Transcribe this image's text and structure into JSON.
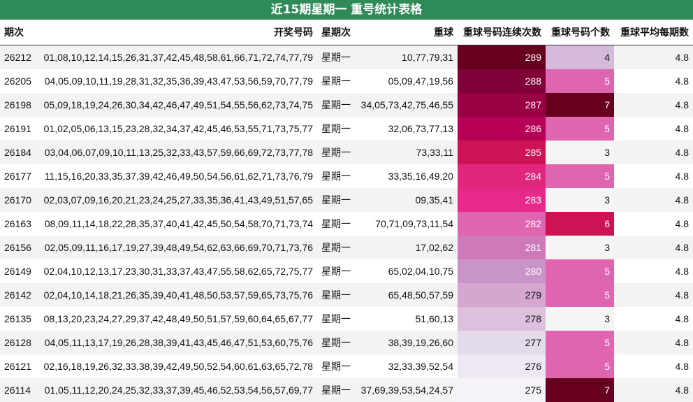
{
  "title": "近15期星期一 重号统计表格",
  "headers": {
    "period": "期次",
    "numbers": "开奖号码",
    "weekday": "星期次",
    "repeat": "重球",
    "consecutive": "重球号码连续次数",
    "count": "重球号码个数",
    "avg": "重球平均每期数"
  },
  "colors": {
    "title_bg": "#2e8b57",
    "consecutive_scale": [
      "#67001f",
      "#7f0036",
      "#980043",
      "#b70055",
      "#ce1256",
      "#e0267d",
      "#e7298a",
      "#df65b0",
      "#cf7ab8",
      "#c994c7",
      "#d4a6d0",
      "#dcc0dc",
      "#e4dbea",
      "#ede8f3",
      "#f5f2f8"
    ],
    "count_colors": {
      "3": "#f5f5f5",
      "4": "#d4b9da",
      "5": "#df65b0",
      "6": "#ce1256",
      "7": "#67001f"
    }
  },
  "rows": [
    {
      "period": "26212",
      "numbers": "01,08,10,12,14,15,26,31,37,42,45,48,58,61,66,71,72,74,77,79",
      "weekday": "星期一",
      "repeat": "10,77,79,31",
      "consecutive": 289,
      "count": 4,
      "avg": "4.8"
    },
    {
      "period": "26205",
      "numbers": "04,05,09,10,11,19,28,31,32,35,36,39,43,47,53,56,59,70,77,79",
      "weekday": "星期一",
      "repeat": "05,09,47,19,56",
      "consecutive": 288,
      "count": 5,
      "avg": "4.8"
    },
    {
      "period": "26198",
      "numbers": "05,09,18,19,24,26,30,34,42,46,47,49,51,54,55,56,62,73,74,75",
      "weekday": "星期一",
      "repeat": "34,05,73,42,75,46,55",
      "consecutive": 287,
      "count": 7,
      "avg": "4.8"
    },
    {
      "period": "26191",
      "numbers": "01,02,05,06,13,15,23,28,32,34,37,42,45,46,53,55,71,73,75,77",
      "weekday": "星期一",
      "repeat": "32,06,73,77,13",
      "consecutive": 286,
      "count": 5,
      "avg": "4.8"
    },
    {
      "period": "26184",
      "numbers": "03,04,06,07,09,10,11,13,25,32,33,43,57,59,66,69,72,73,77,78",
      "weekday": "星期一",
      "repeat": "73,33,11",
      "consecutive": 285,
      "count": 3,
      "avg": "4.8"
    },
    {
      "period": "26177",
      "numbers": "11,15,16,20,33,35,37,39,42,46,49,50,54,56,61,62,71,73,76,79",
      "weekday": "星期一",
      "repeat": "33,35,16,49,20",
      "consecutive": 284,
      "count": 5,
      "avg": "4.8"
    },
    {
      "period": "26170",
      "numbers": "02,03,07,09,16,20,21,23,24,25,27,33,35,36,41,43,49,51,57,65",
      "weekday": "星期一",
      "repeat": "09,35,41",
      "consecutive": 283,
      "count": 3,
      "avg": "4.8"
    },
    {
      "period": "26163",
      "numbers": "08,09,11,14,18,22,28,35,37,40,41,42,45,50,54,58,70,71,73,74",
      "weekday": "星期一",
      "repeat": "70,71,09,73,11,54",
      "consecutive": 282,
      "count": 6,
      "avg": "4.8"
    },
    {
      "period": "26156",
      "numbers": "02,05,09,11,16,17,19,27,39,48,49,54,62,63,66,69,70,71,73,76",
      "weekday": "星期一",
      "repeat": "17,02,62",
      "consecutive": 281,
      "count": 3,
      "avg": "4.8"
    },
    {
      "period": "26149",
      "numbers": "02,04,10,12,13,17,23,30,31,33,37,43,47,55,58,62,65,72,75,77",
      "weekday": "星期一",
      "repeat": "65,02,04,10,75",
      "consecutive": 280,
      "count": 5,
      "avg": "4.8"
    },
    {
      "period": "26142",
      "numbers": "02,04,10,14,18,21,26,35,39,40,41,48,50,53,57,59,65,73,75,76",
      "weekday": "星期一",
      "repeat": "65,48,50,57,59",
      "consecutive": 279,
      "count": 5,
      "avg": "4.8"
    },
    {
      "period": "26135",
      "numbers": "08,13,20,23,24,27,29,37,42,48,49,50,51,57,59,60,64,65,67,77",
      "weekday": "星期一",
      "repeat": "51,60,13",
      "consecutive": 278,
      "count": 3,
      "avg": "4.8"
    },
    {
      "period": "26128",
      "numbers": "04,05,11,13,17,19,26,28,38,39,41,43,45,46,47,51,53,60,75,76",
      "weekday": "星期一",
      "repeat": "38,39,19,26,60",
      "consecutive": 277,
      "count": 5,
      "avg": "4.8"
    },
    {
      "period": "26121",
      "numbers": "02,16,18,19,26,32,33,38,39,42,49,50,52,54,60,61,63,65,72,78",
      "weekday": "星期一",
      "repeat": "32,33,39,52,54",
      "consecutive": 276,
      "count": 5,
      "avg": "4.8"
    },
    {
      "period": "26114",
      "numbers": "01,05,11,12,20,24,25,32,33,37,39,45,46,52,53,54,56,57,69,77",
      "weekday": "星期一",
      "repeat": "37,69,39,53,54,24,57",
      "consecutive": 275,
      "count": 7,
      "avg": "4.8"
    }
  ]
}
